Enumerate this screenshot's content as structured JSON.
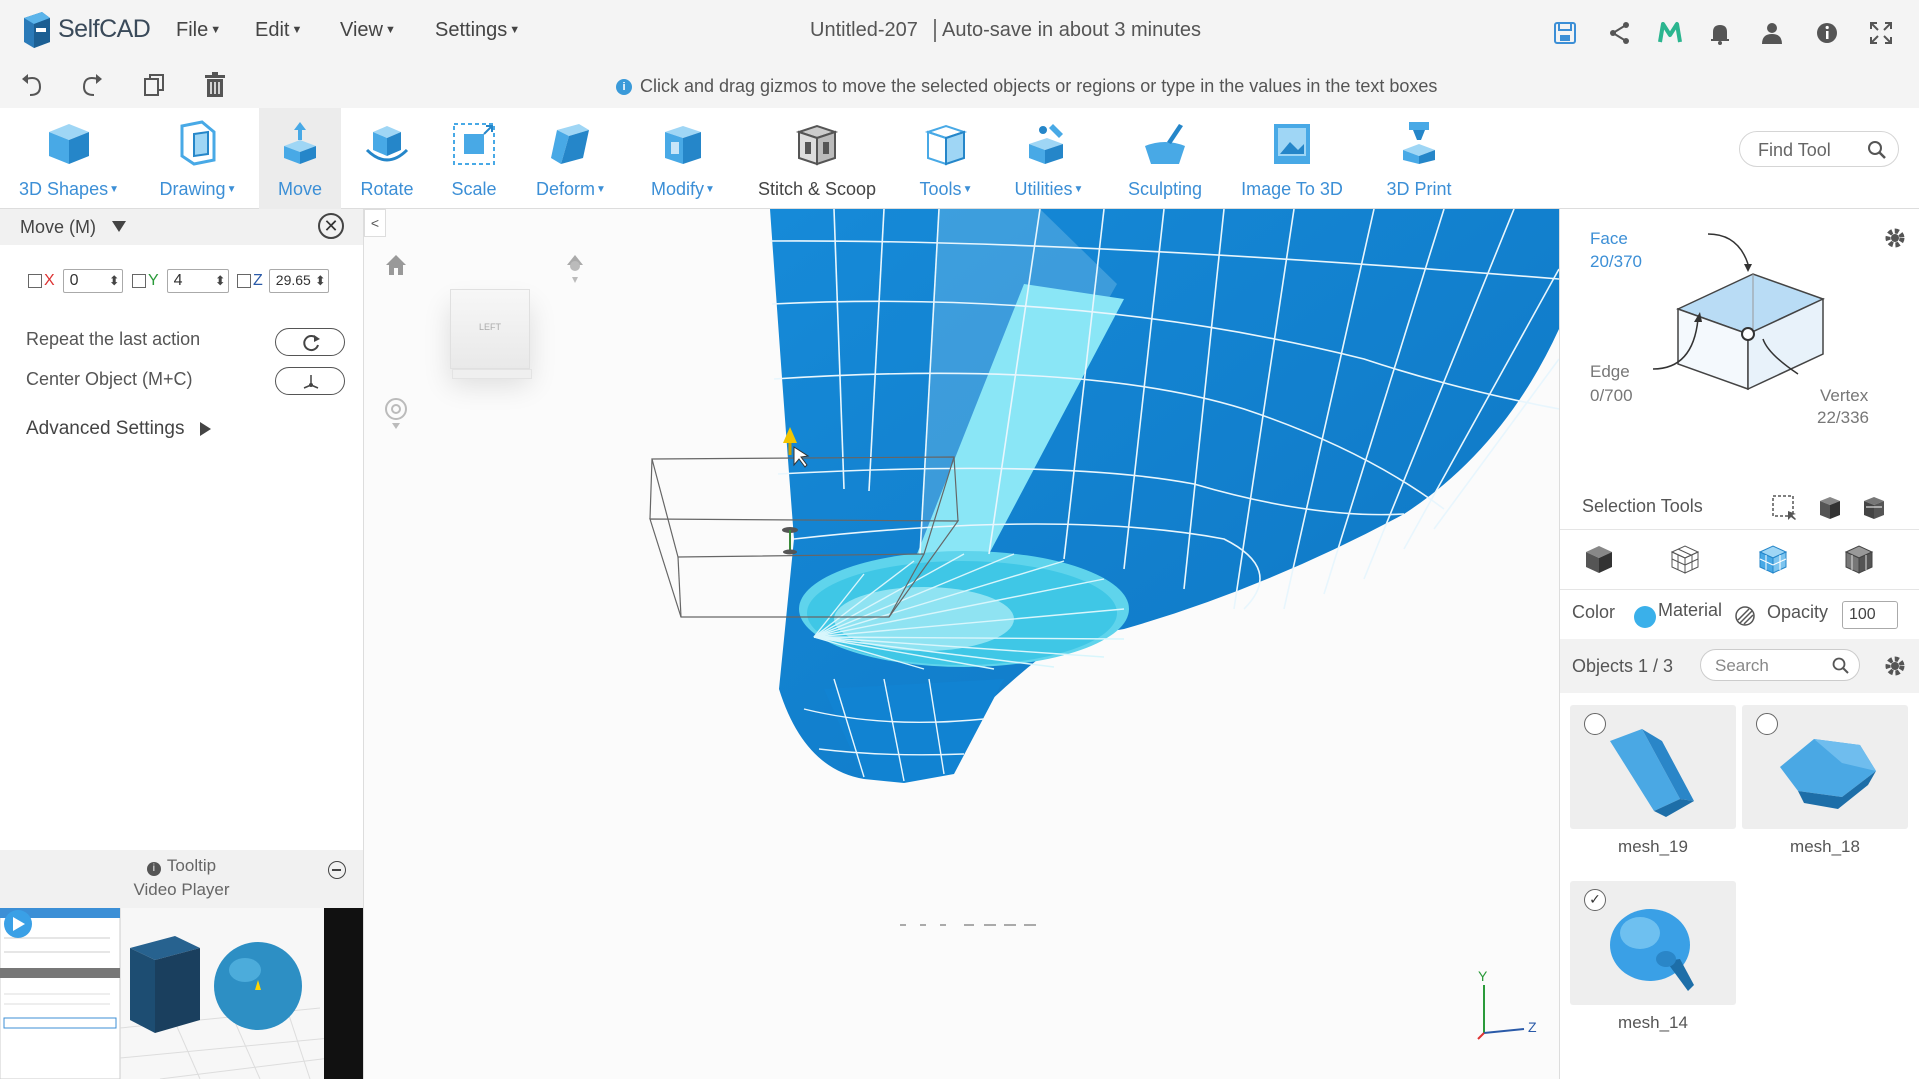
{
  "app": {
    "logo_text": "SelfCAD",
    "document_title": "Untitled-207",
    "autosave_text": "Auto-save in about 3 minutes"
  },
  "menu": [
    "File",
    "Edit",
    "View",
    "Settings"
  ],
  "hint": "Click and drag gizmos to move the selected objects or regions or type in the values in the text boxes",
  "toolbar": {
    "tools": [
      {
        "label": "3D Shapes",
        "dropdown": true
      },
      {
        "label": "Drawing",
        "dropdown": true
      },
      {
        "label": "Move",
        "dropdown": false
      },
      {
        "label": "Rotate",
        "dropdown": false
      },
      {
        "label": "Scale",
        "dropdown": false
      },
      {
        "label": "Deform",
        "dropdown": true
      },
      {
        "label": "Modify",
        "dropdown": true
      },
      {
        "label": "Stitch & Scoop",
        "dropdown": false
      },
      {
        "label": "Tools",
        "dropdown": true
      },
      {
        "label": "Utilities",
        "dropdown": true
      },
      {
        "label": "Sculpting",
        "dropdown": false
      },
      {
        "label": "Image To 3D",
        "dropdown": false
      },
      {
        "label": "3D Print",
        "dropdown": false
      }
    ],
    "find_tool_placeholder": "Find Tool"
  },
  "move_panel": {
    "title": "Move (M)",
    "x_label": "X",
    "x_value": "0",
    "y_label": "Y",
    "y_value": "4",
    "z_label": "Z",
    "z_value": "29.65",
    "repeat_label": "Repeat the last action",
    "center_label": "Center Object (M+C)",
    "advanced_label": "Advanced Settings"
  },
  "tooltip": {
    "title": "Tooltip",
    "subtitle": "Video Player"
  },
  "viewcube_face": "LEFT",
  "selection": {
    "face_label": "Face",
    "face_count": "20/370",
    "edge_label": "Edge",
    "edge_count": "0/700",
    "vertex_label": "Vertex",
    "vertex_count": "22/336",
    "tools_label": "Selection Tools"
  },
  "properties": {
    "color_label": "Color",
    "color_value": "#3ab0ea",
    "material_label": "Material",
    "opacity_label": "Opacity",
    "opacity_value": "100"
  },
  "objects": {
    "count_label": "Objects 1 / 3",
    "search_placeholder": "Search",
    "items": [
      {
        "name": "mesh_19",
        "checked": false
      },
      {
        "name": "mesh_18",
        "checked": false
      },
      {
        "name": "mesh_14",
        "checked": true
      }
    ]
  },
  "axes": {
    "y": "Y",
    "z": "Z"
  },
  "colors": {
    "accent": "#3c8fd6",
    "mesh": "#1a8fdc",
    "selected_face": "#8ae6f6"
  }
}
